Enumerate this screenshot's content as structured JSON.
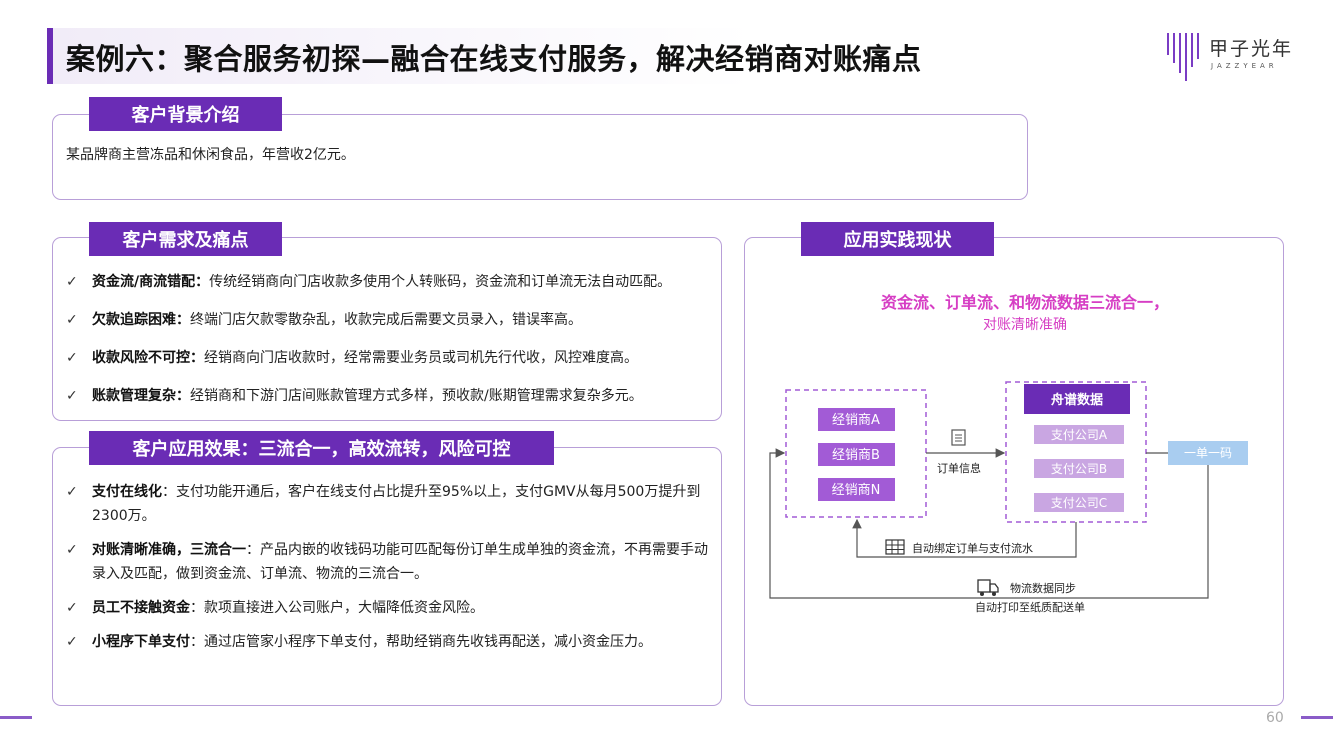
{
  "title": "案例六：聚合服务初探—融合在线支付服务，解决经销商对账痛点",
  "logo": {
    "cn": "甲子光年",
    "en": "JAZZYEAR"
  },
  "background": {
    "tag": "客户背景介绍",
    "text": "某品牌商主营冻品和休闲食品，年营收2亿元。"
  },
  "needs": {
    "tag": "客户需求及痛点",
    "items": [
      {
        "bold": "资金流/商流错配：",
        "text": "传统经销商向门店收款多使用个人转账码，资金流和订单流无法自动匹配。"
      },
      {
        "bold": "欠款追踪困难：",
        "text": "终端门店欠款零散杂乱，收款完成后需要文员录入，错误率高。"
      },
      {
        "bold": "收款风险不可控：",
        "text": "经销商向门店收款时，经常需要业务员或司机先行代收，风控难度高。"
      },
      {
        "bold": "账款管理复杂：",
        "text": "经销商和下游门店间账款管理方式多样，预收款/账期管理需求复杂多元。"
      }
    ]
  },
  "effects": {
    "tag": "客户应用效果：三流合一，高效流转，风险可控",
    "items": [
      {
        "bold": "支付在线化",
        "text": "：支付功能开通后，客户在线支付占比提升至95%以上，支付GMV从每月500万提升到2300万。"
      },
      {
        "bold": "对账清晰准确，三流合一",
        "text": "：产品内嵌的收钱码功能可匹配每份订单生成单独的资金流，不再需要手动录入及匹配，做到资金流、订单流、物流的三流合一。"
      },
      {
        "bold": "员工不接触资金",
        "text": "：款项直接进入公司账户，大幅降低资金风险。"
      },
      {
        "bold": "小程序下单支付",
        "text": "：通过店管家小程序下单支付，帮助经销商先收钱再配送，减小资金压力。"
      }
    ]
  },
  "practice": {
    "tag": "应用实践现状",
    "headline1": "资金流、订单流、和物流数据三流合一，",
    "headline2": "对账清晰准确",
    "dealers": [
      "经销商A",
      "经销商B",
      "经销商N"
    ],
    "platform": "舟谱数据",
    "payments": [
      "支付公司A",
      "支付公司B",
      "支付公司C"
    ],
    "order_info": "订单信息",
    "one_code": "一单一码",
    "auto_bind": "自动绑定订单与支付流水",
    "logistics_sync": "物流数据同步",
    "auto_print": "自动打印至纸质配送单",
    "colors": {
      "accent": "#6a2cb5",
      "pink": "#d63ec4",
      "box": "#a25bd6",
      "light_box": "#c9a6e2",
      "blue": "#a9cdf0"
    }
  },
  "page_number": "60"
}
